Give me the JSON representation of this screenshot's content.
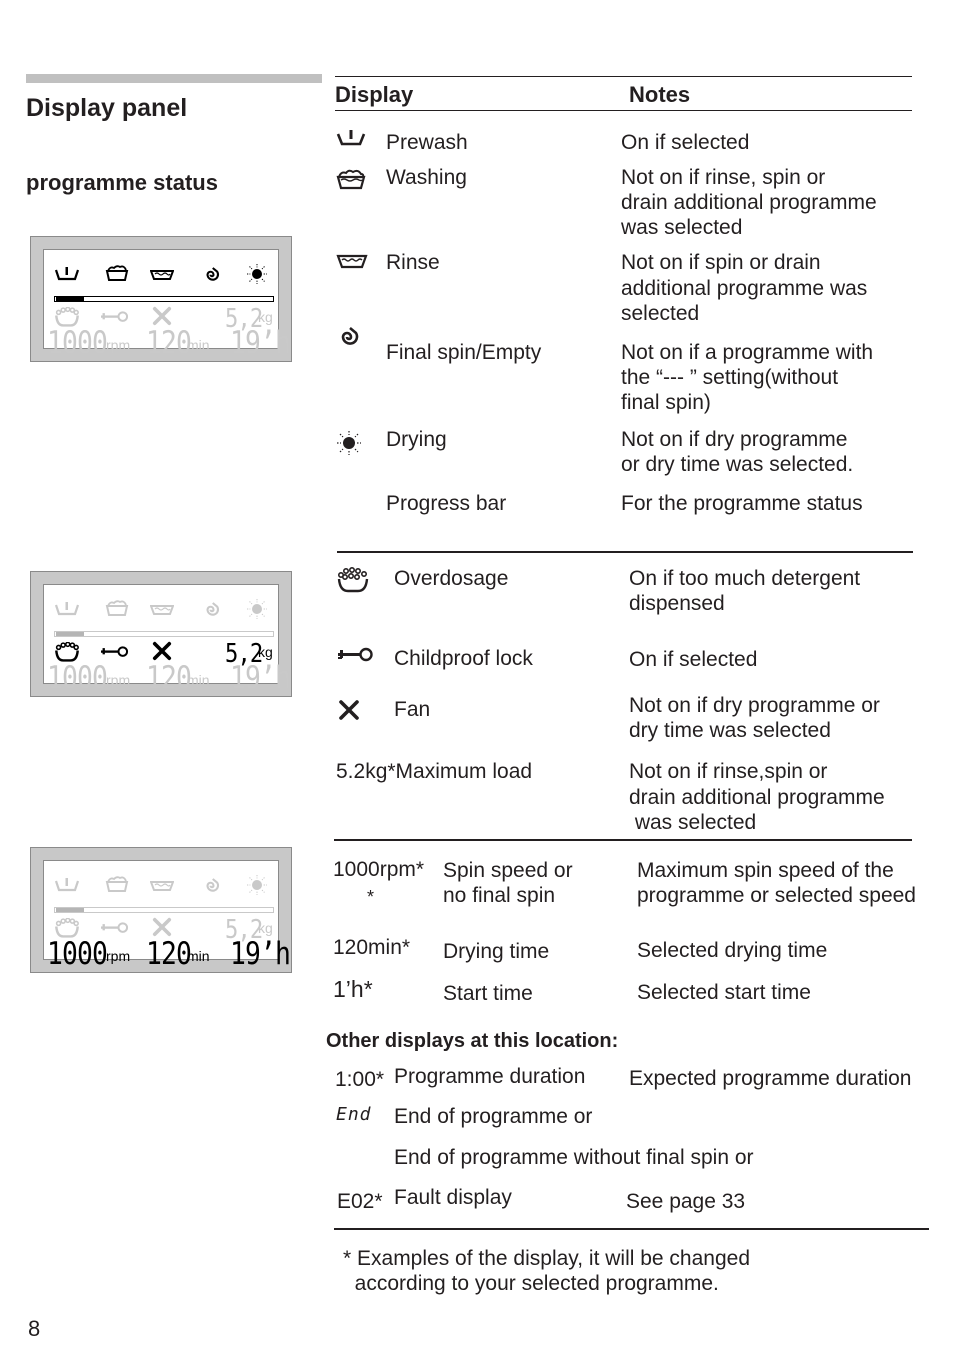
{
  "page": {
    "title": "Display panel",
    "section": "programme status",
    "page_number": "8"
  },
  "table": {
    "headers": {
      "display": "Display",
      "notes": "Notes"
    },
    "programme_status": [
      {
        "icon": "prewash-icon",
        "label": "Prewash",
        "notes": [
          "On if selected"
        ]
      },
      {
        "icon": "washing-icon",
        "label": "Washing",
        "notes": [
          "Not on if rinse, spin or",
          "drain additional programme",
          "was selected"
        ]
      },
      {
        "icon": "rinse-icon",
        "label": "Rinse",
        "notes": [
          "Not on if spin or drain",
          "additional programme was",
          "selected"
        ]
      },
      {
        "icon": "spin-icon",
        "label": "Final spin/Empty",
        "notes": [
          "Not on if a programme with",
          "the “--- ” setting(without",
          "final spin)"
        ]
      },
      {
        "icon": "drying-icon",
        "label": "Drying",
        "notes": [
          "Not on if dry programme",
          "or dry time was selected."
        ]
      },
      {
        "icon": "",
        "label": "Progress bar",
        "notes": [
          "For the programme status"
        ]
      }
    ],
    "options": [
      {
        "icon": "overdosage-icon",
        "label": "Overdosage",
        "notes": [
          "On if too much detergent",
          "dispensed"
        ]
      },
      {
        "icon": "childproof-lock-icon",
        "label": "Childproof lock",
        "notes": [
          "On if selected"
        ]
      },
      {
        "icon": "fan-icon",
        "label": "Fan",
        "notes": [
          "Not on if dry programme or",
          "dry time was selected"
        ]
      },
      {
        "prefix": "5.2kg*",
        "label": "Maximum load",
        "notes": [
          "Not on if rinse,spin or",
          "drain additional programme",
          " was selected"
        ]
      }
    ],
    "values": [
      {
        "prefix": "1000rpm*",
        "prefix2": "*",
        "label": [
          "Spin speed or",
          "no final spin"
        ],
        "notes": [
          "Maximum spin speed of the",
          "programme or selected speed"
        ]
      },
      {
        "prefix": "120min*",
        "label": [
          "Drying time"
        ],
        "notes": [
          "Selected drying time"
        ]
      },
      {
        "prefix": "1’h*",
        "label": [
          "Start time"
        ],
        "notes": [
          "Selected start time"
        ]
      }
    ],
    "other_heading": "Other displays at this location:",
    "other": [
      {
        "prefix": "1:00*",
        "label": "Programme duration",
        "notes": "Expected programme duration"
      },
      {
        "prefix": "End",
        "label": "End of programme or",
        "notes": ""
      },
      {
        "prefix": "",
        "label": "End of programme without final spin or",
        "notes": ""
      },
      {
        "prefix": "E02*",
        "label": "Fault display",
        "notes": "See page 33"
      }
    ],
    "footnote": [
      "* Examples of the display, it will be changed",
      "  according to your selected programme."
    ]
  },
  "lcd": {
    "digits_rpm": "1000",
    "unit_rpm": "rpm",
    "digits_min": "120",
    "unit_min": "min",
    "digits_start": "19’h",
    "load": "5,2",
    "unit_load": "kg",
    "progress_fraction": 0.13,
    "colors": {
      "on": "#000000",
      "off": "#c9c9c9",
      "frame": "#c8c8c8"
    }
  }
}
